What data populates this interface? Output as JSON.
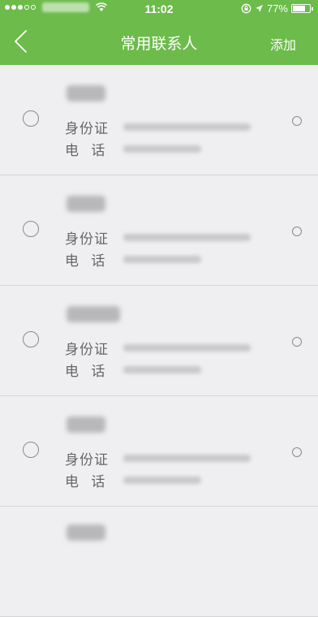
{
  "status_bar": {
    "time": "11:02",
    "battery_text": "77%",
    "battery_level": 0.77,
    "signal_dots_filled": 3,
    "signal_dots_total": 5
  },
  "nav": {
    "title": "常用联系人",
    "add_label": "添加",
    "back_icon": "chevron-left-icon"
  },
  "contacts": [
    {
      "id_label": "身份证",
      "phone_label": "电 话"
    },
    {
      "id_label": "身份证",
      "phone_label": "电 话"
    },
    {
      "id_label": "身份证",
      "phone_label": "电 话"
    },
    {
      "id_label": "身份证",
      "phone_label": "电 话"
    },
    {
      "id_label": "",
      "phone_label": ""
    }
  ],
  "colors": {
    "header_green": "#6cbb4b",
    "background": "#efeff1",
    "divider": "#d4d4d6",
    "label_text": "#666666"
  }
}
